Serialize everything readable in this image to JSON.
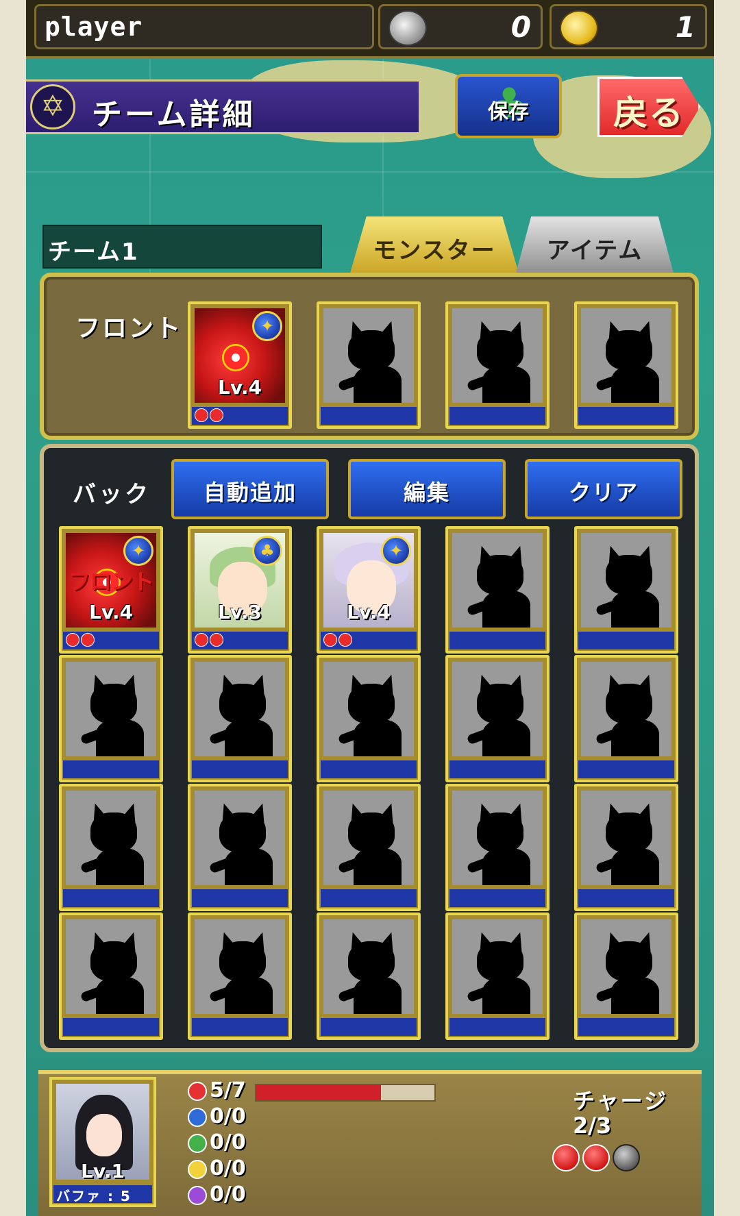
{
  "top_bar": {
    "player_name": "player",
    "silver_coins": "0",
    "gold_coins": "1"
  },
  "header": {
    "title": "チーム詳細",
    "save_label": "保存",
    "back_label": "戻る"
  },
  "team": {
    "name": "チーム1",
    "tabs": [
      "モンスター",
      "アイテム"
    ],
    "active_tab": "モンスター"
  },
  "front": {
    "label": "フロント",
    "slots": [
      {
        "type": "red-dragon",
        "level": "Lv.4",
        "badge_icon": "dragon-badge-icon",
        "dots": 2
      },
      {
        "type": "empty"
      },
      {
        "type": "empty"
      },
      {
        "type": "empty"
      }
    ]
  },
  "back": {
    "label": "バック",
    "buttons": [
      "自動追加",
      "編集",
      "クリア"
    ],
    "slots": [
      {
        "type": "red-dragon",
        "level": "Lv.4",
        "badge_icon": "dragon-badge-icon",
        "dots": 2,
        "tag": "フロント"
      },
      {
        "type": "green-girl",
        "level": "Lv.3",
        "badge_icon": "clover-badge-icon",
        "dots": 2
      },
      {
        "type": "elf-girl",
        "level": "Lv.4",
        "badge_icon": "dragon-badge-icon",
        "dots": 2
      }
    ],
    "total_slots": 20
  },
  "leader": {
    "level": "Lv.1",
    "buffer_label": "バファ : 5"
  },
  "stats": [
    {
      "color": "#e53131",
      "value": "5/7"
    },
    {
      "color": "#2f6bd9",
      "value": "0/0"
    },
    {
      "color": "#43b04a",
      "value": "0/0"
    },
    {
      "color": "#f1d23a",
      "value": "0/0"
    },
    {
      "color": "#9c4ad8",
      "value": "0/0"
    }
  ],
  "hp_fraction": 0.7,
  "charge": {
    "label": "チャージ",
    "value": "2/3",
    "filled": 2,
    "total": 3
  }
}
